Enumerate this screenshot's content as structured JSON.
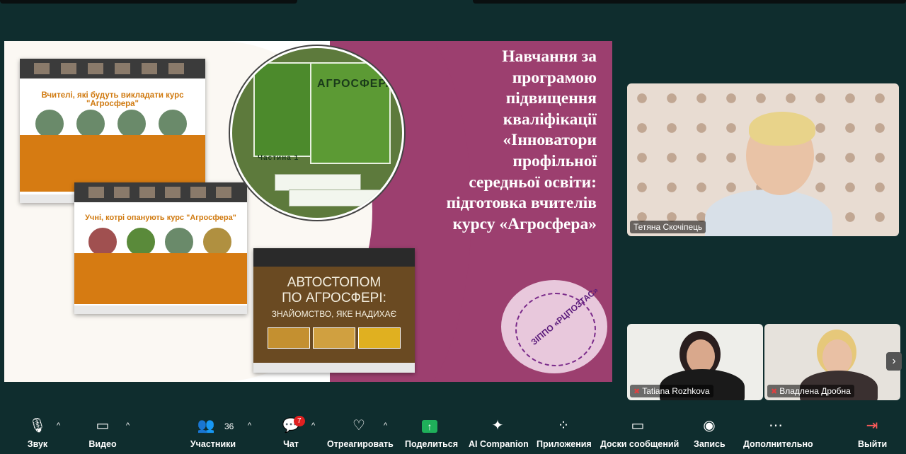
{
  "slide": {
    "title_lines": [
      "Навчання за",
      "програмою",
      "підвищення",
      "кваліфікації",
      "«Інноватори",
      "профільної",
      "середньої освіти:",
      "підготовка вчителів",
      "курсу «Агросфера»"
    ],
    "thumb1_header": "Вчителі, які будуть викладати курс \"Агросфера\"",
    "thumb2_header": "Учні, котрі опанують курс \"Агросфера\"",
    "book_label_1": "АГРОСФЕРА",
    "book_label_2": "Частина 1",
    "video_title_line1": "АВТОСТОПОМ",
    "video_title_line2": "ПО АГРОСФЕРІ:",
    "video_subtitle": "ЗНАЙОМСТВО, ЯКЕ НАДИХАЄ",
    "logo_text": "ЗІППО «РЦПОЗТАС»"
  },
  "participants": {
    "main": "Тетяна Скочіпець",
    "p2": "Tatiana Rozhkova",
    "p3": "Владлена Дробна"
  },
  "toolbar": {
    "sound": "Звук",
    "video": "Видео",
    "participants": "Участники",
    "participants_count": "36",
    "chat": "Чат",
    "chat_badge": "7",
    "react": "Отреагировать",
    "share": "Поделиться",
    "ai": "AI Companion",
    "apps": "Приложения",
    "whiteboards": "Доски сообщений",
    "record": "Запись",
    "more": "Дополнительно",
    "leave": "Выйти"
  },
  "icons": {
    "sound": "mic-muted-icon",
    "video": "camera-icon",
    "participants": "people-icon",
    "chat": "chat-icon",
    "react": "heart-icon",
    "share": "share-screen-icon",
    "ai": "sparkle-icon",
    "apps": "apps-icon",
    "whiteboards": "whiteboard-icon",
    "record": "record-icon",
    "more": "more-icon",
    "leave": "leave-icon"
  }
}
